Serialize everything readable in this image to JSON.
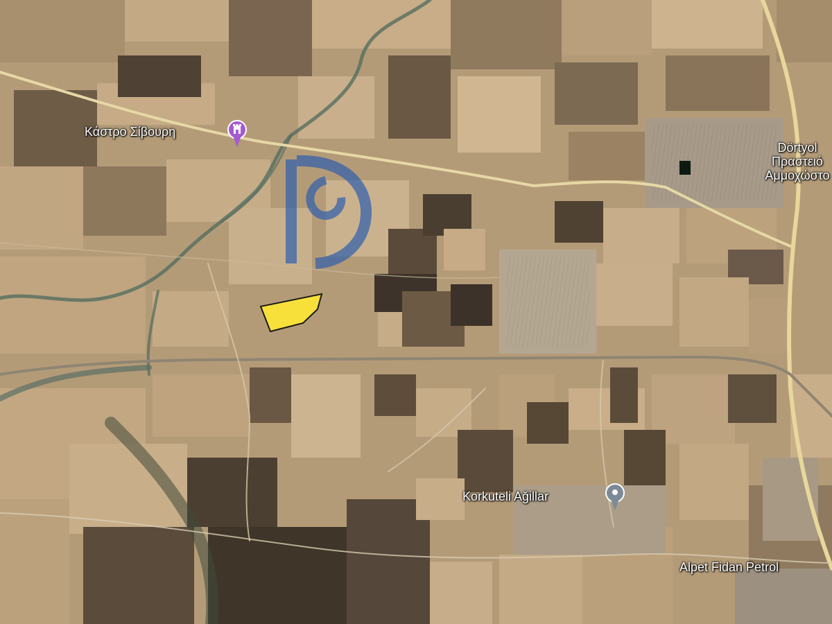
{
  "map": {
    "type": "satellite",
    "colors": {
      "field_light": "#c9ad88",
      "field_mid": "#a88e6c",
      "field_dark": "#5e4e3c",
      "field_darkest": "#3f3528",
      "road": "#e6d9a8",
      "highway": "#e9d9a0",
      "river": "#4f7265",
      "parcel_fill": "#f7e03a",
      "parcel_stroke": "#1a1a1a",
      "watermark": "#2f5fae",
      "poi_purple": "#a45bd0",
      "poi_gray": "#7c8a98"
    },
    "pois": [
      {
        "name": "Κάστρο Σίβουρη",
        "icon": "castle-icon"
      },
      {
        "name": "Korkuteli Ağillar",
        "icon": "location-pin-icon"
      },
      {
        "name": "Alpet Fidan Petrol",
        "icon": ""
      }
    ],
    "places": {
      "line1": "Dörtyol",
      "line2": "Πραστειό",
      "line3": "Αμμοχώστο"
    },
    "highlighted_parcel": "yellow-plot",
    "watermark_icon": "agency-logo-watermark"
  }
}
